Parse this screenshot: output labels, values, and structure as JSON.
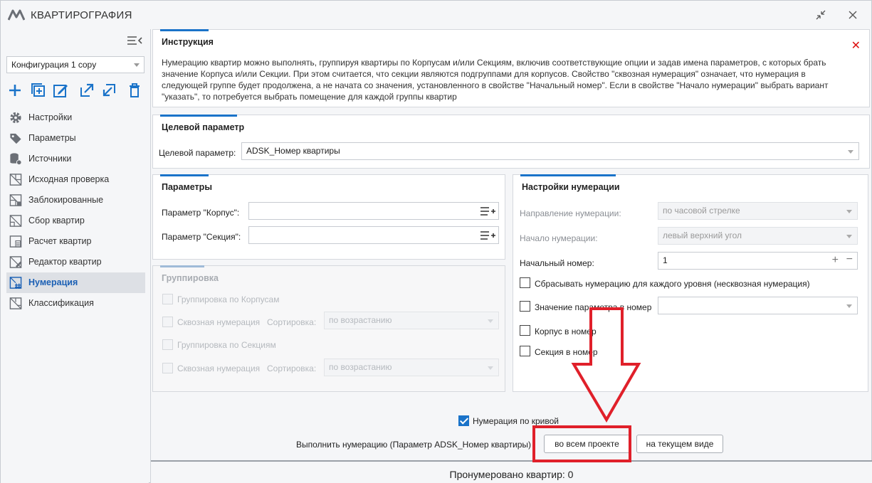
{
  "app": {
    "title": "КВАРТИРОГРАФИЯ"
  },
  "sidebar": {
    "config_value": "Конфигурация 1 copy",
    "nav": [
      {
        "label": "Настройки",
        "icon": "gear-icon"
      },
      {
        "label": "Параметры",
        "icon": "tags-icon"
      },
      {
        "label": "Источники",
        "icon": "database-icon"
      },
      {
        "label": "Исходная проверка",
        "icon": "check-plan-icon"
      },
      {
        "label": "Заблокированные",
        "icon": "locked-plan-icon"
      },
      {
        "label": "Сбор квартир",
        "icon": "collect-plan-icon"
      },
      {
        "label": "Расчет квартир",
        "icon": "calc-plan-icon"
      },
      {
        "label": "Редактор квартир",
        "icon": "edit-plan-icon"
      },
      {
        "label": "Нумерация",
        "icon": "numbering-icon"
      },
      {
        "label": "Классификация",
        "icon": "classification-icon"
      }
    ],
    "active_index": 8
  },
  "instruction": {
    "title": "Инструкция",
    "text": "Нумерацию квартир можно выполнять, группируя квартиры по Корпусам и/или Секциям, включив соответствующие опции и задав имена параметров, с которых брать значение Корпуса и/или Секции. При этом считается, что секции являются подгруппами для корпусов. Свойство \"сквозная нумерация\" означает, что нумерация в следующей группе будет продолжена, а не начата со значения, установленного в свойстве \"Начальный номер\". Если в свойстве \"Начало нумерации\" выбрать вариант \"указать\", то потребуется выбрать помещение для каждой группы квартир"
  },
  "target": {
    "title": "Целевой параметр",
    "label": "Целевой параметр:",
    "value": "ADSK_Номер квартиры"
  },
  "params": {
    "title": "Параметры",
    "korpus_label": "Параметр \"Корпус\":",
    "sekciya_label": "Параметр \"Секция\":",
    "korpus_value": "",
    "sekciya_value": ""
  },
  "grouping": {
    "title": "Группировка",
    "by_korpus": "Группировка по Корпусам",
    "through1": "Сквозная нумерация",
    "sort1_label": "Сортировка:",
    "sort1_value": "по возрастанию",
    "by_section": "Группировка по Секциям",
    "through2": "Сквозная нумерация",
    "sort2_label": "Сортировка:",
    "sort2_value": "по возрастанию"
  },
  "numbering": {
    "title": "Настройки нумерации",
    "direction_label": "Направление нумерации:",
    "direction_value": "по часовой стрелке",
    "start_label": "Начало нумерации:",
    "start_value": "левый верхний угол",
    "first_label": "Начальный номер:",
    "first_value": "1",
    "reset_label": "Сбрасывать нумерацию для каждого уровня (несквозная нумерация)",
    "value_param_label": "Значение параметра в номер",
    "korpus_in_label": "Корпус в номер",
    "section_in_label": "Секция в номер"
  },
  "actions": {
    "curve_label": "Нумерация по кривой",
    "curve_checked": true,
    "run_label": "Выполнить нумерацию (Параметр ADSK_Номер квартиры)",
    "whole_project": "во всем проекте",
    "current_view": "на текущем виде"
  },
  "status": {
    "text": "Пронумеровано квартир: 0"
  },
  "colors": {
    "accent": "#1a73c9",
    "annotation": "#e0202a"
  }
}
